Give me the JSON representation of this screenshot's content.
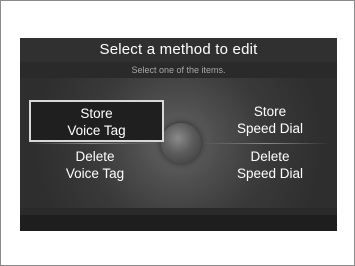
{
  "screen": {
    "title": "Select a method to edit",
    "subtitle": "Select one of the items."
  },
  "menu": {
    "items": [
      {
        "line1": "Store",
        "line2": "Voice Tag",
        "selected": true
      },
      {
        "line1": "Store",
        "line2": "Speed Dial",
        "selected": false
      },
      {
        "line1": "Delete",
        "line2": "Voice Tag",
        "selected": false
      },
      {
        "line1": "Delete",
        "line2": "Speed Dial",
        "selected": false
      }
    ]
  },
  "colors": {
    "screen_background": "#2a2a2a",
    "text": "#ffffff",
    "subtitle_text": "#a8a8a8",
    "selection_border": "#d8d8d8"
  },
  "icons": {
    "center": "interface-dial-knob"
  }
}
